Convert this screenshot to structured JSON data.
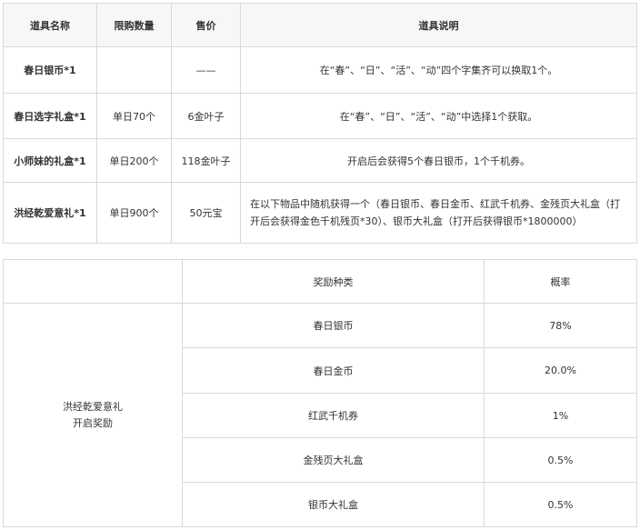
{
  "table1": {
    "headers": [
      "道具名称",
      "限购数量",
      "售价",
      "道具说明"
    ],
    "rows": [
      {
        "name": "春日银币*1",
        "limit": "",
        "price": "——",
        "desc": "在“春”、“日”、“活”、“动”四个字集齐可以换取1个。"
      },
      {
        "name": "春日选字礼盒*1",
        "limit": "单日70个",
        "price": "6金叶子",
        "desc": "在“春”、“日”、“活”、“动”中选择1个获取。"
      },
      {
        "name": "小师妹的礼盒*1",
        "limit": "单日200个",
        "price": "118金叶子",
        "desc": "开启后会获得5个春日银币，1个千机券。"
      },
      {
        "name": "洪经乾爱意礼*1",
        "limit": "单日900个",
        "price": "50元宝",
        "desc": "在以下物品中随机获得一个（春日银币、春日金币、红武千机券、金残页大礼盒（打开后会获得金色千机残页*30）、银币大礼盒（打开后获得银币*1800000）"
      }
    ]
  },
  "table2": {
    "label_line1": "洪经乾爱意礼",
    "label_line2": "开启奖励",
    "headers": [
      "奖励种类",
      "概率"
    ],
    "rows": [
      {
        "item": "春日银币",
        "prob": "78%"
      },
      {
        "item": "春日金币",
        "prob": "20.0%"
      },
      {
        "item": "红武千机券",
        "prob": "1%"
      },
      {
        "item": "金残页大礼盒",
        "prob": "0.5%"
      },
      {
        "item": "银币大礼盒",
        "prob": "0.5%"
      }
    ]
  }
}
